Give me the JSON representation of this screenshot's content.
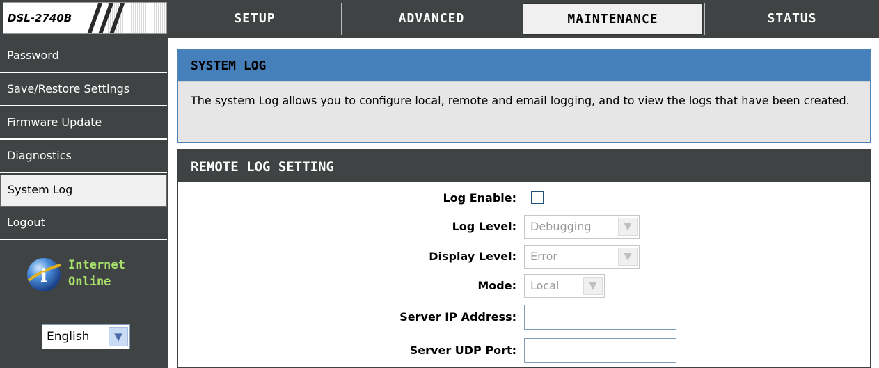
{
  "header": {
    "model": "DSL-2740B",
    "tabs": [
      {
        "label": "SETUP"
      },
      {
        "label": "ADVANCED"
      },
      {
        "label": "MAINTENANCE"
      },
      {
        "label": "STATUS"
      }
    ],
    "active_tab": "MAINTENANCE"
  },
  "sidebar": {
    "items": [
      {
        "label": "Password"
      },
      {
        "label": "Save/Restore Settings"
      },
      {
        "label": "Firmware Update"
      },
      {
        "label": "Diagnostics"
      },
      {
        "label": "System Log"
      },
      {
        "label": "Logout"
      }
    ],
    "active_item": "System Log",
    "status": {
      "line1": "Internet",
      "line2": "Online",
      "icon": "info-globe-icon"
    },
    "language": {
      "value": "English"
    }
  },
  "system_log": {
    "title": "SYSTEM LOG",
    "description": "The system Log allows you to configure local, remote and email logging, and to view the logs that have been created."
  },
  "remote_log": {
    "title": "REMOTE LOG SETTING",
    "log_enable": {
      "label": "Log Enable:",
      "checked": false
    },
    "log_level": {
      "label": "Log Level:",
      "value": "Debugging"
    },
    "display_level": {
      "label": "Display Level:",
      "value": "Error"
    },
    "mode": {
      "label": "Mode:",
      "value": "Local"
    },
    "server_ip": {
      "label": "Server IP Address:",
      "value": ""
    },
    "server_port": {
      "label": "Server UDP Port:",
      "value": ""
    }
  },
  "colors": {
    "dark": "#404343",
    "blue_header": "#4680bb",
    "status_green": "#a9e26a"
  }
}
